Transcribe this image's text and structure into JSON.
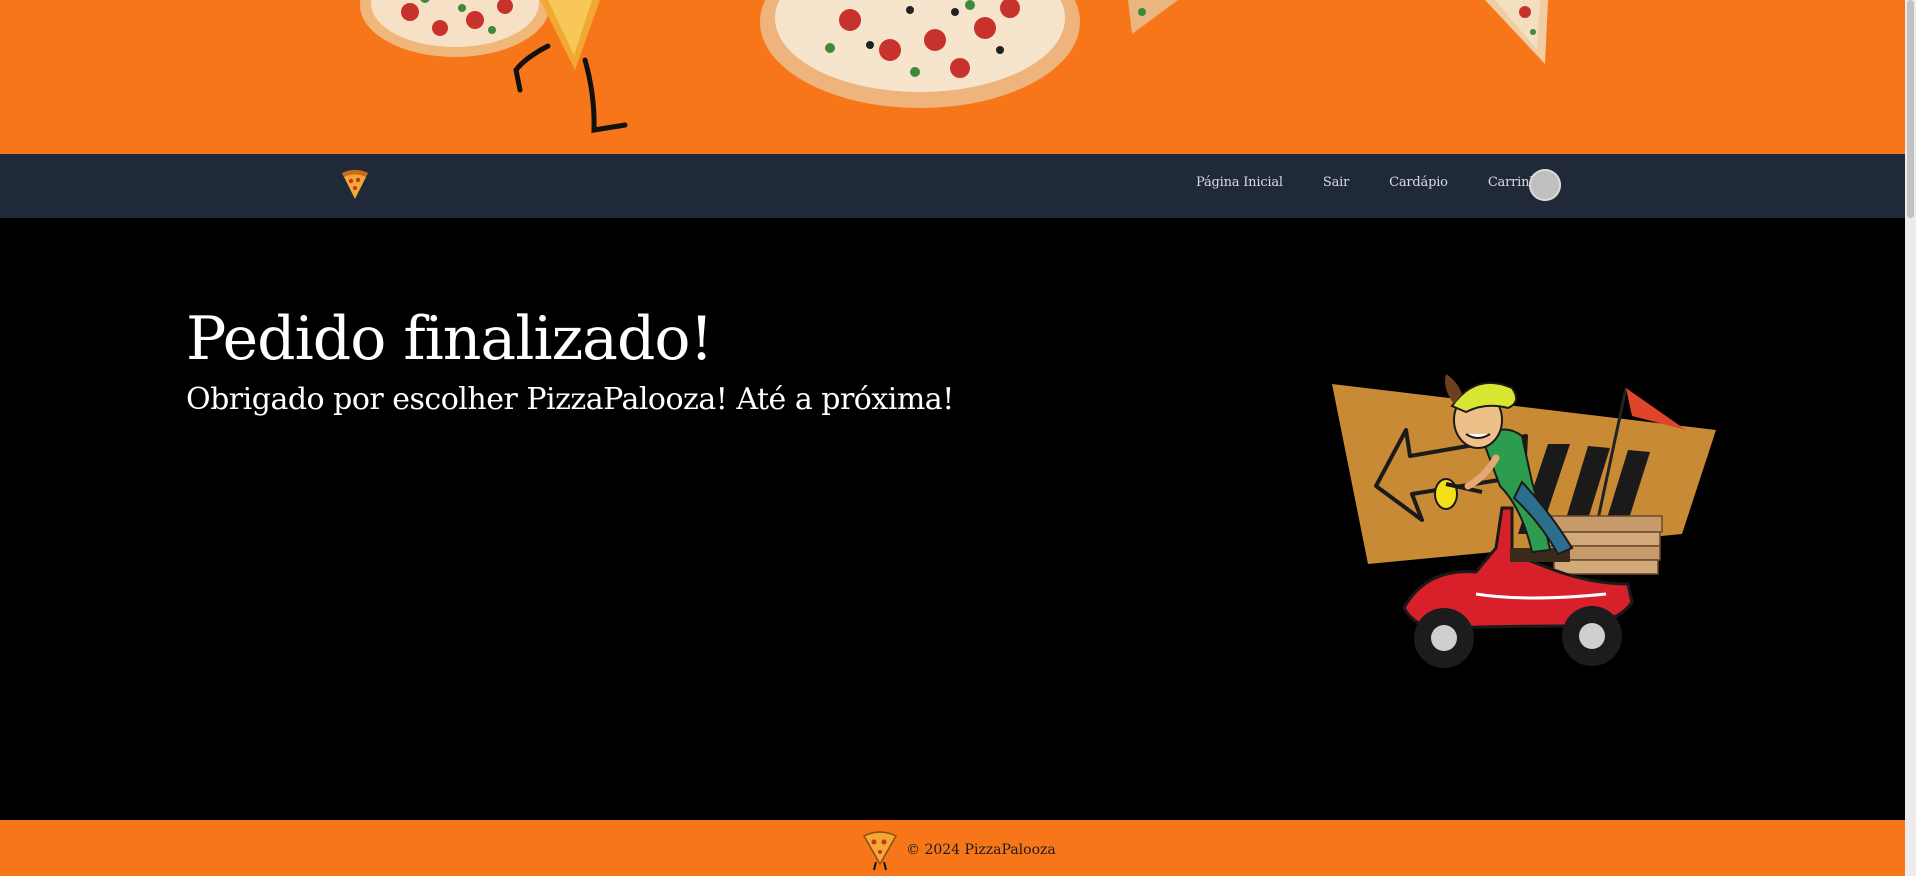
{
  "colors": {
    "brand_orange": "#f77619",
    "navbar_bg": "#202938",
    "main_bg": "#000000",
    "text_light": "#ffffff"
  },
  "banner": {
    "image": "pizza-banner"
  },
  "navbar": {
    "logo_icon": "pizza-slice-icon",
    "links": [
      {
        "label": "Página Inicial"
      },
      {
        "label": "Sair"
      },
      {
        "label": "Cardápio"
      },
      {
        "label": "Carrinho"
      }
    ],
    "avatar_icon": "user-avatar-icon"
  },
  "main": {
    "title": "Pedido finalizado!",
    "subtitle": "Obrigado por escolher PizzaPalooza! Até a próxima!",
    "illustration": "delivery-scooter-illustration"
  },
  "footer": {
    "logo_icon": "pizza-mascot-icon",
    "text": "© 2024 PizzaPalooza"
  }
}
